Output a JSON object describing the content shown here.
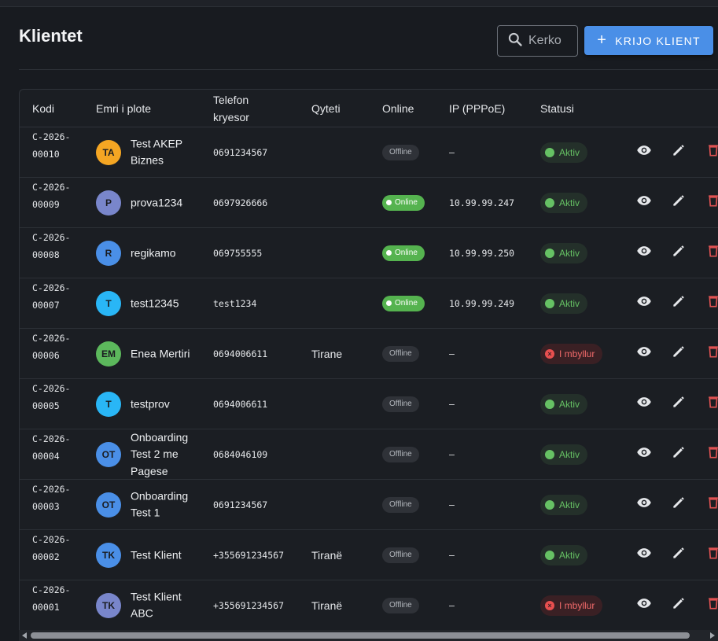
{
  "page": {
    "title": "Klientet"
  },
  "search": {
    "placeholder": "Kerko"
  },
  "actions": {
    "create_label": "KRIJO KLIENT"
  },
  "table": {
    "headers": {
      "code": "Kodi",
      "name": "Emri i plote",
      "phone": "Telefon kryesor",
      "city": "Qyteti",
      "online": "Online",
      "ip": "IP (PPPoE)",
      "status": "Statusi"
    },
    "rows": [
      {
        "code": "C-2026-00010",
        "initials": "TA",
        "avatar_color": "#f5a623",
        "name": "Test AKEP Biznes",
        "phone": "0691234567",
        "city": "",
        "online": "Offline",
        "ip": "–",
        "status": "Aktiv"
      },
      {
        "code": "C-2026-00009",
        "initials": "P",
        "avatar_color": "#7986cb",
        "name": "prova1234",
        "phone": "0697926666",
        "city": "",
        "online": "Online",
        "ip": "10.99.99.247",
        "status": "Aktiv"
      },
      {
        "code": "C-2026-00008",
        "initials": "R",
        "avatar_color": "#4a8fe7",
        "name": "regikamo",
        "phone": "069755555",
        "city": "",
        "online": "Online",
        "ip": "10.99.99.250",
        "status": "Aktiv"
      },
      {
        "code": "C-2026-00007",
        "initials": "T",
        "avatar_color": "#29b6f6",
        "name": "test12345",
        "phone": "test1234",
        "city": "",
        "online": "Online",
        "ip": "10.99.99.249",
        "status": "Aktiv"
      },
      {
        "code": "C-2026-00006",
        "initials": "EM",
        "avatar_color": "#5cb85c",
        "name": "Enea Mertiri",
        "phone": "0694006611",
        "city": "Tirane",
        "online": "Offline",
        "ip": "–",
        "status": "I mbyllur"
      },
      {
        "code": "C-2026-00005",
        "initials": "T",
        "avatar_color": "#29b6f6",
        "name": "testprov",
        "phone": "0694006611",
        "city": "",
        "online": "Offline",
        "ip": "–",
        "status": "Aktiv"
      },
      {
        "code": "C-2026-00004",
        "initials": "OT",
        "avatar_color": "#4a8fe7",
        "name": "Onboarding Test 2 me Pagese",
        "phone": "0684046109",
        "city": "",
        "online": "Offline",
        "ip": "–",
        "status": "Aktiv"
      },
      {
        "code": "C-2026-00003",
        "initials": "OT",
        "avatar_color": "#4a8fe7",
        "name": "Onboarding Test 1",
        "phone": "0691234567",
        "city": "",
        "online": "Offline",
        "ip": "–",
        "status": "Aktiv"
      },
      {
        "code": "C-2026-00002",
        "initials": "TK",
        "avatar_color": "#4a8fe7",
        "name": "Test Klient",
        "phone": "+355691234567",
        "city": "Tiranë",
        "online": "Offline",
        "ip": "–",
        "status": "Aktiv"
      },
      {
        "code": "C-2026-00001",
        "initials": "TK",
        "avatar_color": "#7986cb",
        "name": "Test Klient ABC",
        "phone": "+355691234567",
        "city": "Tiranë",
        "online": "Offline",
        "ip": "–",
        "status": "I mbyllur"
      }
    ]
  },
  "icons": {
    "search": "search-icon",
    "add": "plus-icon",
    "view": "eye-icon",
    "edit": "pencil-icon",
    "delete": "trash-icon"
  },
  "colors": {
    "accent": "#4a8fe7",
    "online": "#55b34f",
    "active": "#66c164",
    "closed": "#e84f4f",
    "delete": "#e05252"
  }
}
